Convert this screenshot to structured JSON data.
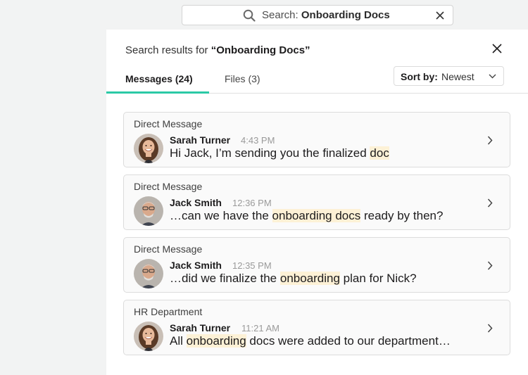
{
  "search": {
    "prefix": "Search:",
    "query": "Onboarding Docs"
  },
  "panel": {
    "title_prefix": "Search results for ",
    "title_query": "“Onboarding Docs”"
  },
  "tabs": [
    {
      "label": "Messages (24)",
      "active": true
    },
    {
      "label": "Files (3)",
      "active": false
    }
  ],
  "sort": {
    "label": "Sort by:",
    "value": "Newest"
  },
  "results": [
    {
      "channel": "Direct Message",
      "author": "Sarah Turner",
      "time": "4:43 PM",
      "avatar": "avatar-woman",
      "snippet_before": "Hi Jack, I’m sending you the finalized ",
      "snippet_highlight": "doc",
      "snippet_after": ""
    },
    {
      "channel": "Direct Message",
      "author": "Jack Smith",
      "time": "12:36 PM",
      "avatar": "avatar-man",
      "snippet_before": "…can we have the ",
      "snippet_highlight": "onboarding docs",
      "snippet_after": " ready by then?"
    },
    {
      "channel": "Direct Message",
      "author": "Jack Smith",
      "time": "12:35 PM",
      "avatar": "avatar-man",
      "snippet_before": "…did we finalize the ",
      "snippet_highlight": "onboarding",
      "snippet_after": " plan for Nick?"
    },
    {
      "channel": "HR Department",
      "author": "Sarah Turner",
      "time": "11:21 AM",
      "avatar": "avatar-woman",
      "snippet_before": "All ",
      "snippet_highlight": "onboarding",
      "snippet_after": " docs were added to our department…"
    }
  ],
  "colors": {
    "accent": "#2bc9a6",
    "highlight": "#fdf1d6"
  }
}
